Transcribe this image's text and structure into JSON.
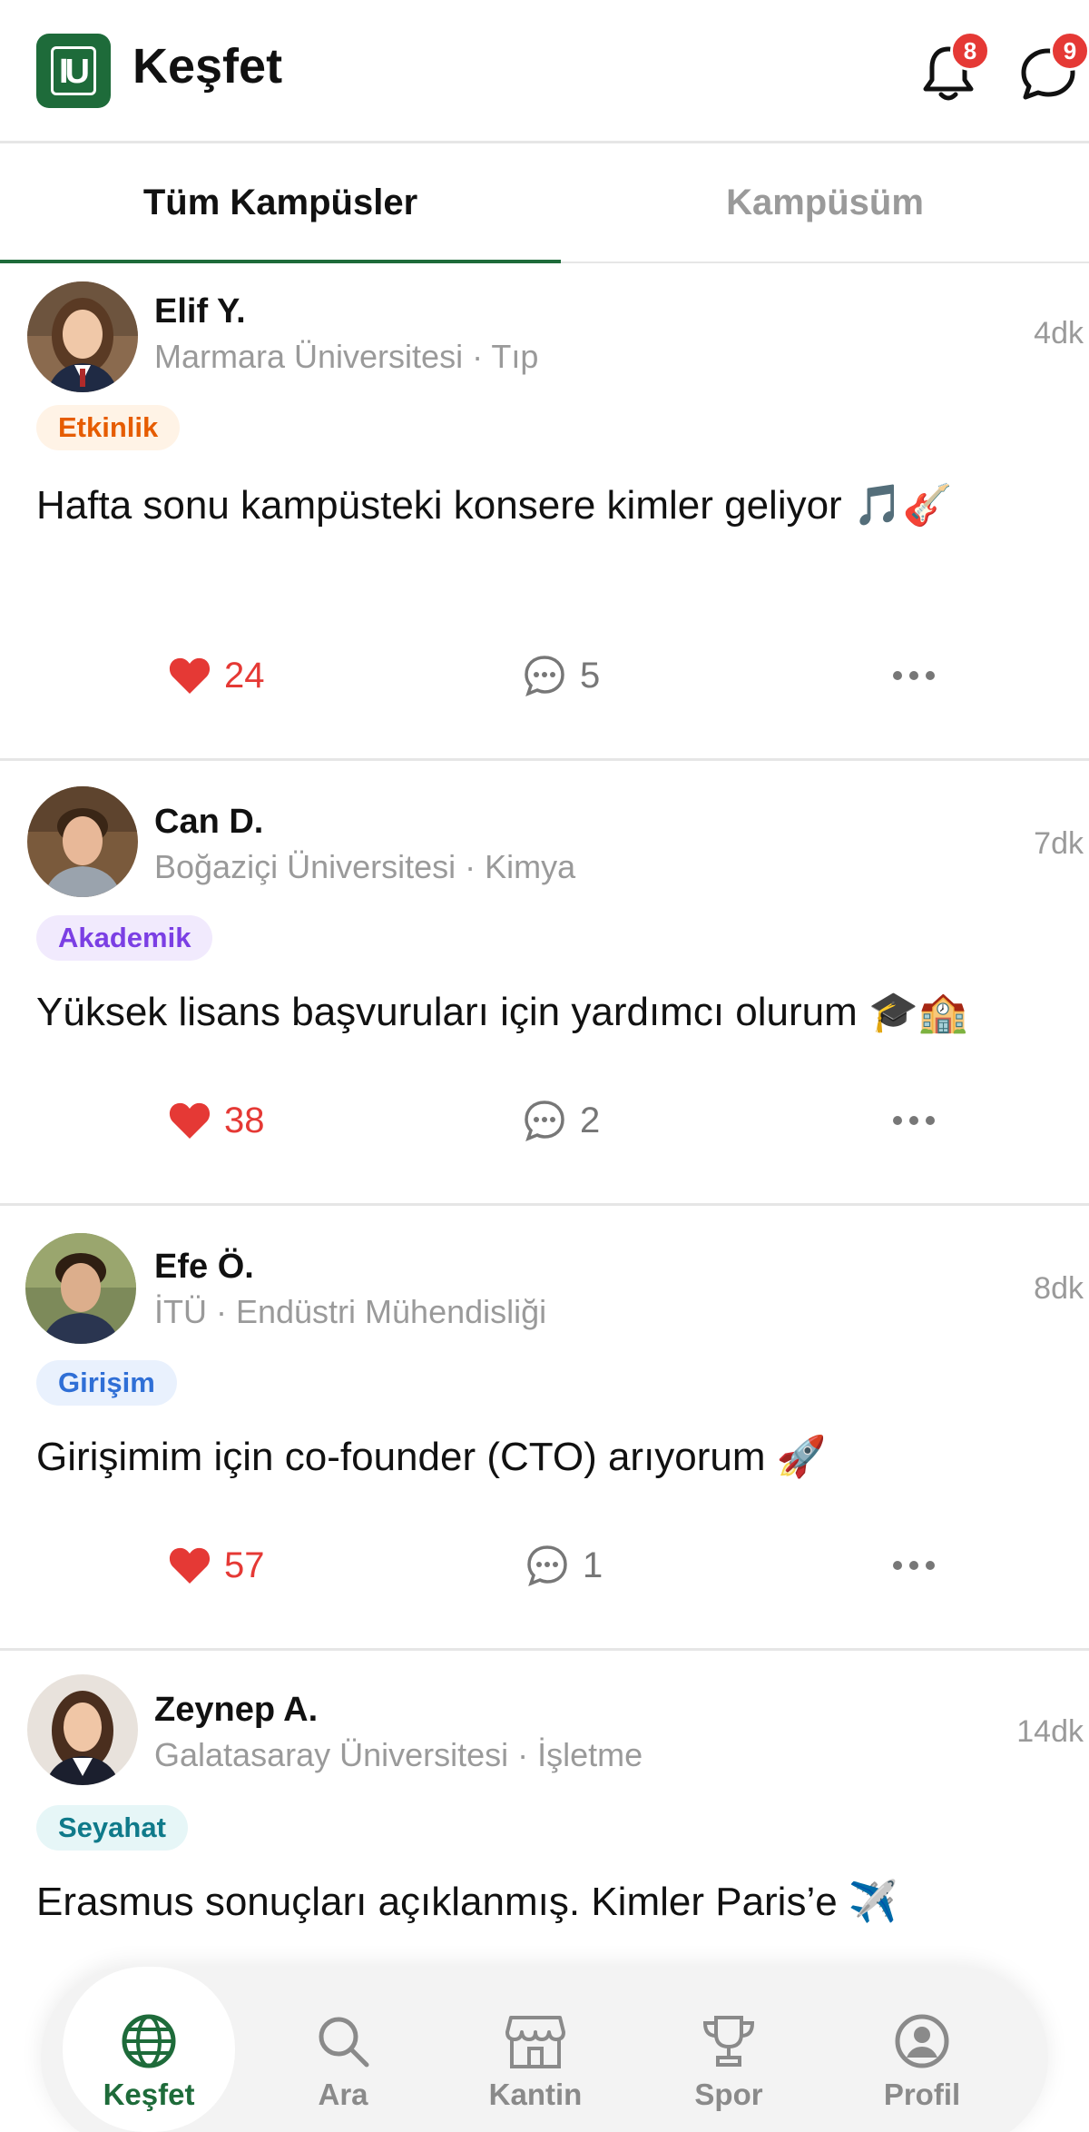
{
  "header": {
    "logo_text": "IU",
    "title": "Keşfet",
    "notifications_count": "8",
    "messages_count": "9"
  },
  "tabs": [
    {
      "label": "Tüm Kampüsler",
      "active": true
    },
    {
      "label": "Kampüsüm",
      "active": false
    }
  ],
  "posts": [
    {
      "author": "Elif Y.",
      "meta": "Marmara Üniversitesi · Tıp",
      "time": "4dk",
      "tag": "Etkinlik",
      "tag_color": "#e65c00",
      "tag_bg": "#fff3e6",
      "content": "Hafta sonu kampüsteki konsere kimler geliyor 🎵🎸",
      "likes": "24",
      "comments": "5"
    },
    {
      "author": "Can D.",
      "meta": "Boğaziçi Üniversitesi · Kimya",
      "time": "7dk",
      "tag": "Akademik",
      "tag_color": "#7b3fe4",
      "tag_bg": "#f1eafd",
      "content": "Yüksek lisans başvuruları için yardımcı olurum 🎓🏫",
      "likes": "38",
      "comments": "2"
    },
    {
      "author": "Efe Ö.",
      "meta": "İTÜ · Endüstri Mühendisliği",
      "time": "8dk",
      "tag": "Girişim",
      "tag_color": "#2f6fd6",
      "tag_bg": "#e9f1fd",
      "content": "Girişimim için co-founder (CTO) arıyorum 🚀",
      "likes": "57",
      "comments": "1"
    },
    {
      "author": "Zeynep A.",
      "meta": "Galatasaray Üniversitesi · İşletme",
      "time": "14dk",
      "tag": "Seyahat",
      "tag_color": "#0f7a8a",
      "tag_bg": "#e6f6f7",
      "content": "Erasmus sonuçları açıklanmış. Kimler Paris’e ✈️",
      "likes": "",
      "comments": ""
    }
  ],
  "bottom_nav": [
    {
      "label": "Keşfet",
      "icon": "globe-icon",
      "active": true
    },
    {
      "label": "Ara",
      "icon": "search-icon",
      "active": false
    },
    {
      "label": "Kantin",
      "icon": "store-icon",
      "active": false
    },
    {
      "label": "Spor",
      "icon": "trophy-icon",
      "active": false
    },
    {
      "label": "Profil",
      "icon": "profile-icon",
      "active": false
    }
  ],
  "colors": {
    "brand": "#1e6b3a",
    "like": "#e53935",
    "badge": "#e53935"
  }
}
